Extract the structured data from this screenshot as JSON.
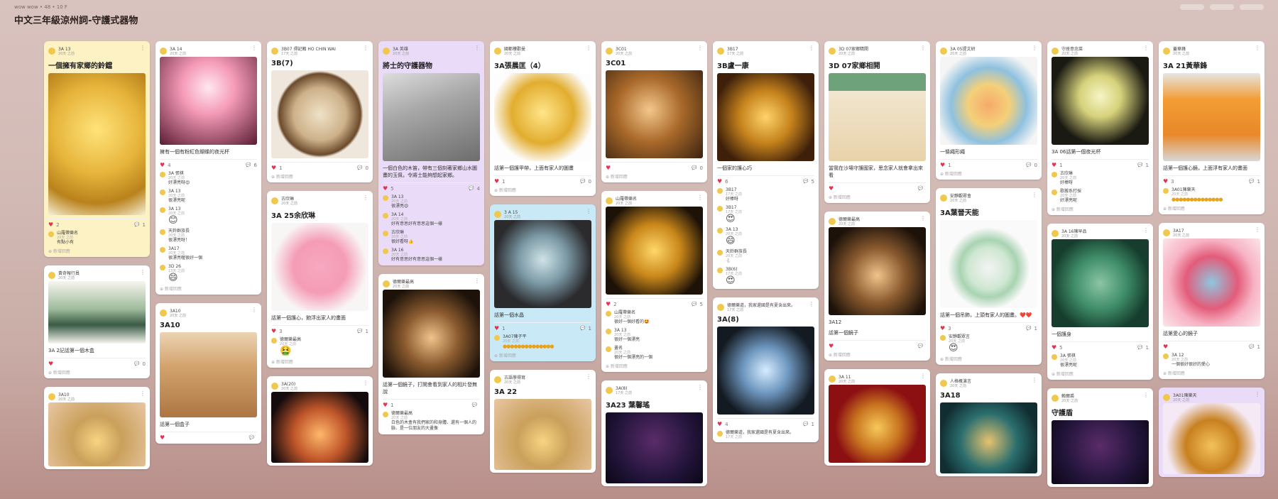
{
  "header": {
    "breadcrumb": "wow wow • 48 • 10 F",
    "title": "中文三年級涼州詞-守護式器物"
  },
  "columns": [
    [
      {
        "style": "yellow",
        "author": "3A 13",
        "time": "20天 之前",
        "title": "一個擁有家鄉的鈴鐺",
        "art": "bell",
        "img_h": 200,
        "likes": "2",
        "comments": "1",
        "replies": [
          {
            "name": "山羅帶樂名",
            "time": "20天 之前",
            "text": "有點小有"
          }
        ],
        "addc": "新增回應"
      },
      {
        "style": "white",
        "author": "黃奇報行員",
        "time": "20天 之前",
        "title": "",
        "art": "box-ink",
        "img_h": 88,
        "caption": "3A 2記話第一個木盒",
        "likes": "",
        "comments": "0",
        "addc": "新增回應"
      },
      {
        "style": "white",
        "author": "3A10",
        "time": "20天 之前",
        "title": "",
        "art": "moon",
        "img_h": 90
      }
    ],
    [
      {
        "style": "white",
        "author": "3A 14",
        "time": "20天 之前",
        "title": "",
        "art": "mug-pink",
        "img_h": 124,
        "caption": "擁有一個有粉紅色蝴蝶的夜光杯",
        "likes": "4",
        "comments": "6",
        "replies": [
          {
            "name": "3A 張棋",
            "time": "20天 之前",
            "text": "好漂亮呀😍"
          },
          {
            "name": "3A 13",
            "time": "20天 之前",
            "text": "很漂亮呢"
          },
          {
            "name": "3A 13",
            "time": "20天 之前",
            "emoji": "😊"
          },
          {
            "name": "天鈴群族長",
            "time": "20天 之前",
            "text": "很漂亮呀！"
          },
          {
            "name": "3A17",
            "time": "20天 之前",
            "text": "很漂亮喔很好一個"
          },
          {
            "name": "3D 26",
            "time": "13天 之前",
            "emoji": "😄"
          }
        ],
        "addc": "新增回應"
      },
      {
        "style": "white",
        "author": "3A10",
        "time": "20天 之前",
        "title": "3A10",
        "art": "woodbox",
        "img_h": 120,
        "caption": "話第一個盒子",
        "likes": "",
        "comments": ""
      }
    ],
    [
      {
        "style": "white",
        "author": "3B07 得記賴 HO CHIN WAI",
        "time": "17天 之前",
        "title": "3B(7)",
        "art": "plate",
        "img_h": 124,
        "likes": "1",
        "comments": "0",
        "addc": "新增回應"
      },
      {
        "style": "white",
        "author": "古欣琳",
        "time": "20天 之前",
        "title": "3A 25余欣琳",
        "art": "vest-pink",
        "img_h": 124,
        "caption": "話第一個護心，飽浮出家人的畫面",
        "likes": "3",
        "comments": "1",
        "replies": [
          {
            "name": "德爾樂最高",
            "time": "20天 之前",
            "emoji": "🤮"
          }
        ],
        "addc": "新增回應"
      },
      {
        "style": "white",
        "author": "3A(20)",
        "time": "20天 之前",
        "title": "",
        "art": "sparkle",
        "img_h": 100
      }
    ],
    [
      {
        "style": "purple",
        "author": "3A 英雄",
        "time": "20天 之前",
        "title": "將士的守護器物",
        "art": "jade-strip",
        "img_h": 124,
        "caption": "一個白色的木笛，帶有三個刻著家鄉山水圖畫的玉佩，令將士能夠想起家鄉。",
        "likes": "5",
        "comments": "4",
        "replies": [
          {
            "name": "3A 13",
            "time": "20天 之前",
            "text": "很漂亮😍"
          },
          {
            "name": "3A 14",
            "time": "20天 之前",
            "text": "好有意思好有意思這個一樣"
          },
          {
            "name": "古欣琳",
            "time": "20天 之前",
            "text": "很好看呀👍"
          },
          {
            "name": "3A 16",
            "time": "20天 之前",
            "text": "好有意思好有意思這個一樣"
          }
        ]
      },
      {
        "style": "white",
        "author": "德爾樂最高",
        "time": "20天 之前",
        "title": "",
        "art": "heart-frame",
        "img_h": 124,
        "caption": "話第一個鏡子，打開會看到家人的相片發無說",
        "likes": "1",
        "comments": "",
        "replies": [
          {
            "name": "德爾樂最高",
            "time": "20天 之前",
            "text": "白色的木盒有我們家的和身體、還有一個人的臉、是一位朋友的大畫像"
          }
        ]
      }
    ],
    [
      {
        "style": "white",
        "author": "國都樓歡曼",
        "time": "20天 之前",
        "title": "3A張晨匡（4）",
        "art": "gold-armor",
        "img_h": 124,
        "caption": "話第一個護甲帶，上面有家人的圖畫",
        "likes": "1",
        "comments": "0",
        "addc": "新增回應"
      },
      {
        "style": "blue",
        "author": "3 A 15",
        "time": "20天 之前",
        "title": "",
        "art": "globe",
        "img_h": 124,
        "caption": "話第一個水晶",
        "likes": "1",
        "comments": "1",
        "replies": [
          {
            "name": "3A07陳子平",
            "time": "20天 之前",
            "dots": true
          }
        ],
        "addc": "新增回應"
      },
      {
        "style": "white",
        "author": "古語學得寫",
        "time": "20天 之前",
        "title": "3A 22",
        "art": "moon",
        "img_h": 100
      }
    ],
    [
      {
        "style": "white",
        "author": "3C01",
        "time": "20天 之前",
        "title": "3C01",
        "art": "cup-warm",
        "img_h": 124,
        "likes": "",
        "comments": "0",
        "addc": "新增回應"
      },
      {
        "style": "white",
        "author": "山羅帶樂名",
        "time": "20天 之前",
        "title": "",
        "art": "mug-gold",
        "img_h": 124,
        "likes": "2",
        "comments": "5",
        "replies": [
          {
            "name": "山羅帶樂名",
            "time": "20天 之前",
            "text": "很好一個好看的🤩"
          },
          {
            "name": "3A 13",
            "time": "20天 之前",
            "text": "很好一個漂亮"
          },
          {
            "name": "畫名",
            "time": "20天 之前",
            "text": "很好一個漂亮的一個"
          }
        ],
        "addc": "新增回應"
      },
      {
        "style": "white",
        "author": "3A(8)",
        "time": "17天 之前",
        "title": "3A23 葉馨瑤",
        "art": "starry",
        "img_h": 100
      }
    ],
    [
      {
        "style": "white",
        "author": "3B17",
        "time": "17天 之前",
        "title": "3B盧一康",
        "art": "gold-disc",
        "img_h": 124,
        "caption": "一個家的護心巧",
        "likes": "6",
        "comments": "5",
        "replies": [
          {
            "name": "3B17",
            "time": "17天 之前",
            "text": "好棒呀"
          },
          {
            "name": "3B17",
            "time": "17天 之前",
            "emoji": "😍"
          },
          {
            "name": "3A 13",
            "time": "20天 之前",
            "emoji": "😄"
          },
          {
            "name": "天鈴群族長",
            "time": "20天 之前",
            "text": "🐇"
          },
          {
            "name": "3B(6)",
            "time": "17天 之前",
            "emoji": "😍"
          }
        ]
      },
      {
        "style": "white",
        "author": "德爾樂道，我家還國是有夏含出來。",
        "time": "17天 之前",
        "title": "3A(8)",
        "art": "cube",
        "img_h": 124,
        "likes": "4",
        "comments": "1",
        "replies": [
          {
            "name": "德爾樂道，我家還國是有夏含出來。",
            "time": "17天 之前"
          }
        ]
      }
    ],
    [
      {
        "style": "white",
        "author": "3D 07家鄉精開",
        "time": "20天 之前",
        "title": "3D 07家鄉相開",
        "art": "pavilion",
        "img_h": 124,
        "caption": "當我在沙場守護國家，思念家人就會拿出來看",
        "likes": "",
        "comments": "",
        "addc": "新增回應"
      },
      {
        "style": "white",
        "author": "德爾樂最高",
        "time": "20天 之前",
        "title": "",
        "art": "heart-frame",
        "img_h": 124,
        "caption": "3A12\n話第一個鏡子",
        "likes": "",
        "comments": "",
        "addc": "新增回應"
      },
      {
        "style": "white",
        "author": "3A 11",
        "time": "20天 之前",
        "title": "",
        "art": "red-gold",
        "img_h": 110
      }
    ],
    [
      {
        "style": "white",
        "author": "3A 05提文研",
        "time": "20天 之前",
        "title": "",
        "art": "rope",
        "img_h": 124,
        "caption": "一條繩形繩",
        "likes": "1",
        "comments": "0",
        "addc": "新增回應"
      },
      {
        "style": "white",
        "author": "安靜觀眾會",
        "time": "20天 之前",
        "title": "3A葉晉天能",
        "art": "pendant",
        "img_h": 124,
        "caption": "話第一個吊飾，上頭有家人的圖畫。❤️❤️",
        "likes": "3",
        "comments": "1",
        "replies": [
          {
            "name": "安靜觀眾言",
            "time": "20天 之前",
            "emoji": "😍"
          }
        ],
        "addc": "新增回應"
      },
      {
        "style": "white",
        "author": "人格概演言",
        "time": "20天 之前",
        "title": "3A18",
        "art": "teal-disc",
        "img_h": 100
      }
    ],
    [
      {
        "style": "white",
        "author": "守座意念菜",
        "time": "20天 之前",
        "title": "",
        "art": "lamp",
        "img_h": 124,
        "caption": "3A 06話第一個夜光杯",
        "likes": "1",
        "comments": "1",
        "replies": [
          {
            "name": "古欣琳",
            "time": "20天 之前",
            "text": "好棒呀"
          },
          {
            "name": "歌搬系打採",
            "time": "20天 之前",
            "text": "好漂亮呢"
          }
        ],
        "addc": "新增回應"
      },
      {
        "style": "white",
        "author": "3A 16陳早品",
        "time": "20天 之前",
        "title": "",
        "art": "jade-green",
        "img_h": 124,
        "caption": "一個護身",
        "likes": "5",
        "comments": "1",
        "replies": [
          {
            "name": "3A 張棋",
            "time": "20天 之前",
            "text": "很漂亮呢"
          }
        ],
        "addc": "新增回應"
      },
      {
        "style": "white",
        "author": "賴爾裘",
        "time": "20天 之前",
        "title": "守護盾",
        "art": "starry",
        "img_h": 90
      }
    ],
    [
      {
        "style": "white",
        "author": "蓋華鋒",
        "time": "20天 之前",
        "title": "3A 21黃華鋒",
        "art": "vest",
        "img_h": 124,
        "caption": "話第一個護心鏡，上面浮有家人的畫面",
        "likes": "3",
        "comments": "1",
        "replies": [
          {
            "name": "3A01陳樂天",
            "time": "20天 之前",
            "dots": true
          }
        ],
        "addc": "新增回應"
      },
      {
        "style": "white",
        "author": "3A17",
        "time": "20天 之前",
        "title": "",
        "art": "heart-pink",
        "img_h": 124,
        "caption": "話第愛心的鏡子",
        "likes": "",
        "comments": "1",
        "replies": [
          {
            "name": "3A 12",
            "time": "20天 之前",
            "text": "一個很好很好的愛心"
          }
        ],
        "addc": "新增回應"
      },
      {
        "style": "purple",
        "author": "3A01陳樂天",
        "time": "20天 之前",
        "title": "",
        "art": "cabin",
        "img_h": 100
      }
    ]
  ]
}
